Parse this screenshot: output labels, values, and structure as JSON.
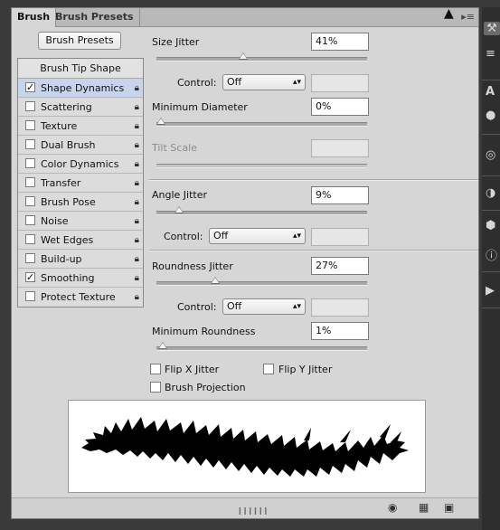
{
  "tabs": {
    "brush": "Brush",
    "brush_presets": "Brush Presets"
  },
  "panel_menu_icon": "panel-menu-icon",
  "brush_presets_button": "Brush Presets",
  "list": {
    "header": "Brush Tip Shape",
    "items": [
      {
        "label": "Shape Dynamics",
        "checked": true,
        "selected": true
      },
      {
        "label": "Scattering",
        "checked": false
      },
      {
        "label": "Texture",
        "checked": false
      },
      {
        "label": "Dual Brush",
        "checked": false
      },
      {
        "label": "Color Dynamics",
        "checked": false
      },
      {
        "label": "Transfer",
        "checked": false
      },
      {
        "label": "Brush Pose",
        "checked": false
      },
      {
        "label": "Noise",
        "checked": false
      },
      {
        "label": "Wet Edges",
        "checked": false
      },
      {
        "label": "Build-up",
        "checked": false
      },
      {
        "label": "Smoothing",
        "checked": true
      },
      {
        "label": "Protect Texture",
        "checked": false
      }
    ]
  },
  "settings": {
    "size_jitter": {
      "label": "Size Jitter",
      "value": "41%",
      "level": 41
    },
    "size_control": {
      "label": "Control:",
      "value": "Off"
    },
    "min_diameter": {
      "label": "Minimum Diameter",
      "value": "0%",
      "level": 0
    },
    "tilt_scale": {
      "label": "Tilt Scale",
      "value": ""
    },
    "angle_jitter": {
      "label": "Angle Jitter",
      "value": "9%",
      "level": 9
    },
    "angle_control": {
      "label": "Control:",
      "value": "Off"
    },
    "roundness_jitter": {
      "label": "Roundness Jitter",
      "value": "27%",
      "level": 27
    },
    "roundness_control": {
      "label": "Control:",
      "value": "Off"
    },
    "min_roundness": {
      "label": "Minimum Roundness",
      "value": "1%",
      "level": 1
    },
    "flip_x": {
      "label": "Flip X Jitter",
      "checked": false
    },
    "flip_y": {
      "label": "Flip Y Jitter",
      "checked": false
    },
    "brush_projection": {
      "label": "Brush Projection",
      "checked": false
    }
  },
  "bottom_icons": [
    "eye-icon",
    "grid-icon",
    "new-preset-icon"
  ],
  "colors": {
    "panel": "#d6d6d6",
    "selected_row": "#c8d4ec",
    "toolbar": "#2e2e2e"
  }
}
